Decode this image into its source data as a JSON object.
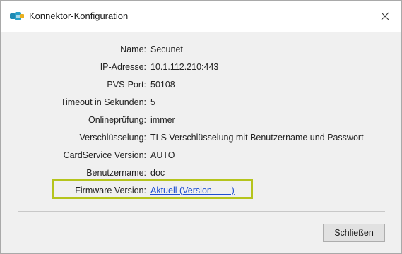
{
  "window": {
    "title": "Konnektor-Konfiguration",
    "icon": "connector-icon",
    "close_icon": "close-icon"
  },
  "fields": [
    {
      "label": "Name:",
      "value": "Secunet"
    },
    {
      "label": "IP-Adresse:",
      "value": "10.1.112.210:443"
    },
    {
      "label": "PVS-Port:",
      "value": "50108"
    },
    {
      "label": "Timeout in Sekunden:",
      "value": "5"
    },
    {
      "label": "Onlineprüfung:",
      "value": "immer"
    },
    {
      "label": "Verschlüsselung:",
      "value": "TLS Verschlüsselung mit Benutzername und Passwort"
    },
    {
      "label": "CardService Version:",
      "value": "AUTO"
    },
    {
      "label": "Benutzername:",
      "value": "doc"
    },
    {
      "label": "Firmware Version:",
      "value": "Aktuell (Version        )"
    }
  ],
  "colors": {
    "highlight": "#b5c41c",
    "link": "#1f4fcf"
  },
  "footer": {
    "close_label": "Schließen"
  }
}
